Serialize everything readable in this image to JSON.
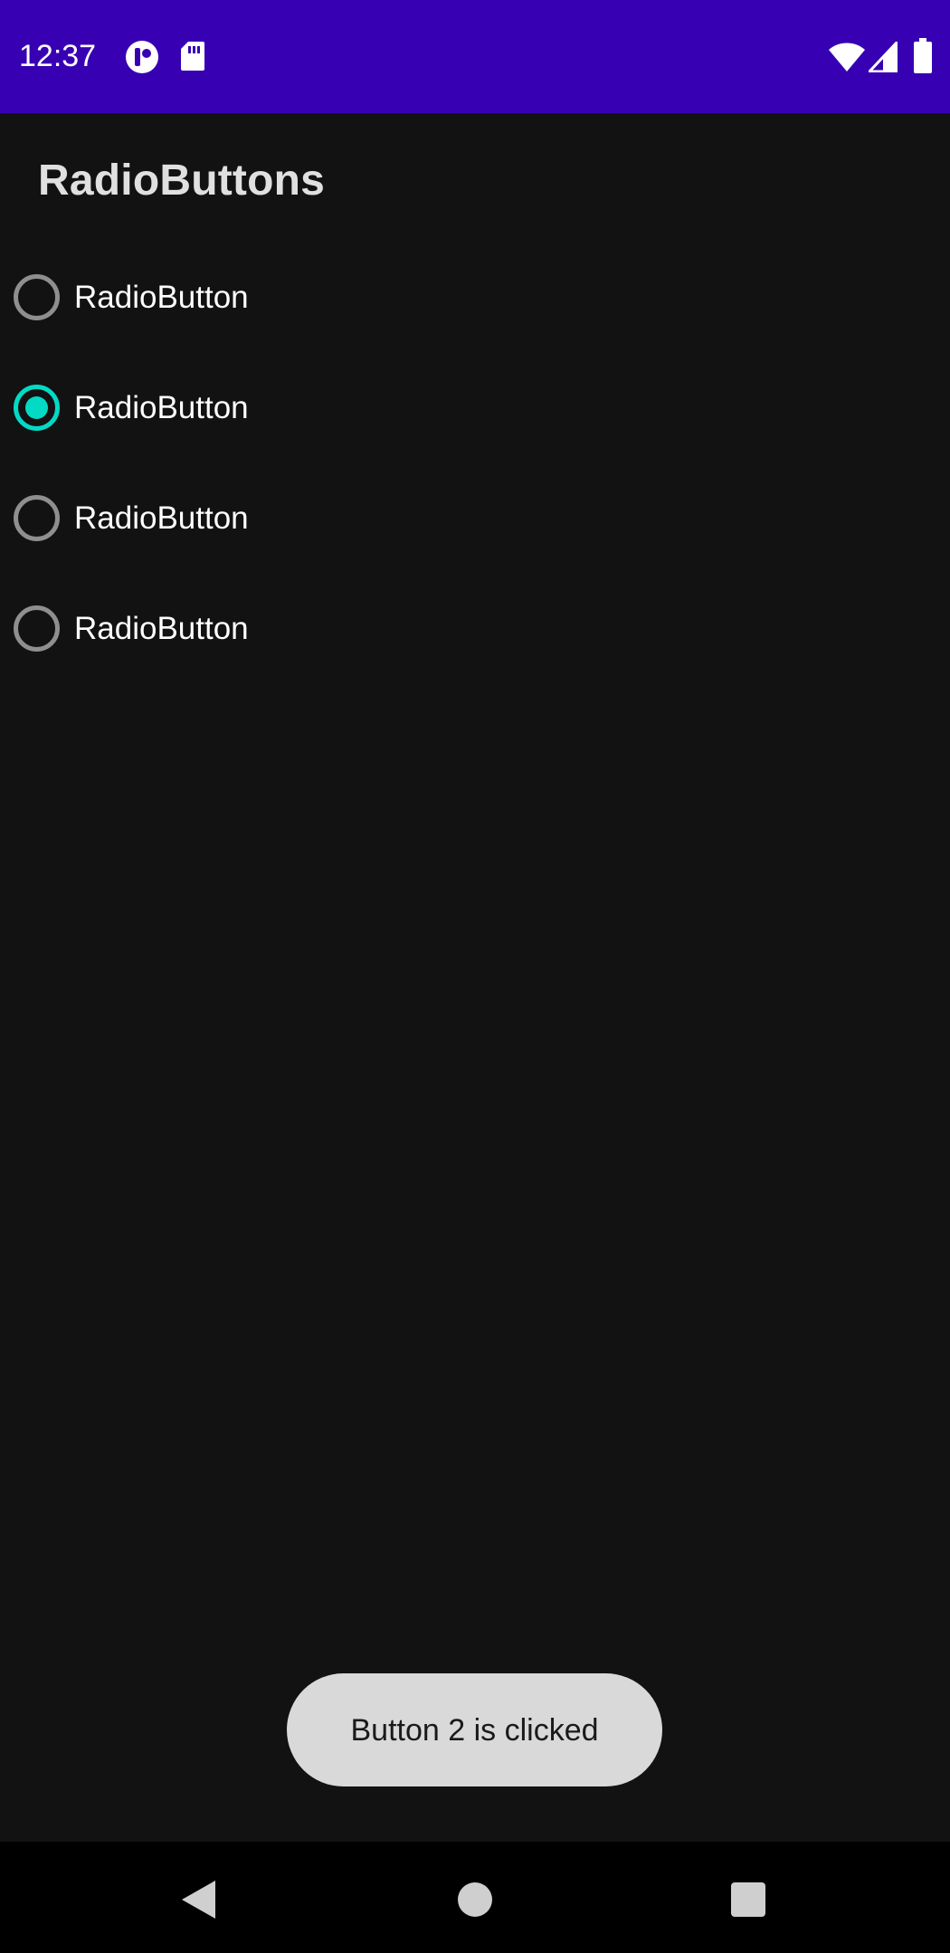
{
  "status_bar": {
    "time": "12:37",
    "background": "#3700b3",
    "left_icons": [
      "notification-app-icon",
      "sd-card-icon"
    ],
    "right_icons": [
      "wifi-icon",
      "cellular-signal-icon",
      "battery-icon"
    ]
  },
  "app": {
    "title": "RadioButtons",
    "accent": "#03dac5",
    "background": "#121212"
  },
  "radio_group": {
    "options": [
      {
        "label": "RadioButton",
        "checked": false
      },
      {
        "label": "RadioButton",
        "checked": true
      },
      {
        "label": "RadioButton",
        "checked": false
      },
      {
        "label": "RadioButton",
        "checked": false
      }
    ]
  },
  "toast": {
    "message": "Button 2 is clicked"
  },
  "nav_bar": {
    "buttons": [
      "back-icon",
      "home-icon",
      "recents-icon"
    ]
  }
}
